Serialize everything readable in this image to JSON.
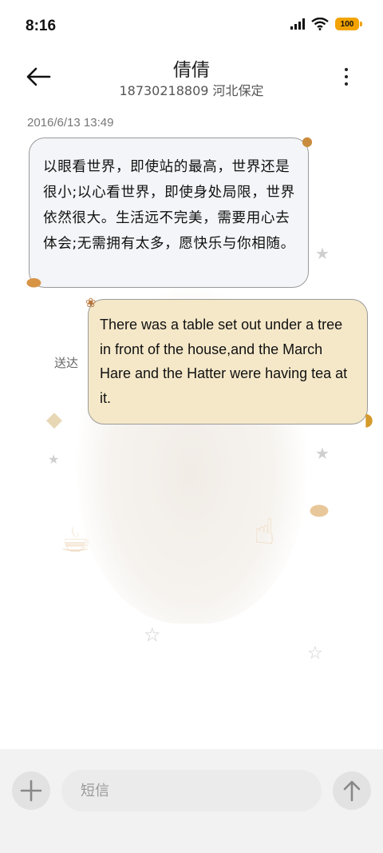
{
  "status_bar": {
    "time": "8:16",
    "battery": "100",
    "battery_color": "#f2a300"
  },
  "header": {
    "contact_name": "倩倩",
    "contact_subtitle": "18730218809 河北保定",
    "back_icon": "arrow-left-icon",
    "more_icon": "more-vertical-icon"
  },
  "conversation": {
    "timestamp": "2016/6/13 13:49",
    "messages": [
      {
        "direction": "received",
        "text": "以眼看世界，即使站的最高，世界还是很小;以心看世界，即使身处局限，世界依然很大。生活远不完美，需要用心去体会;无需拥有太多，愿快乐与你相随。",
        "bubble_color": "#f3f5f8"
      },
      {
        "direction": "sent",
        "text": "There was a table set out under a tree in front of the house,and the March Hare and the Hatter were having tea at it.",
        "bubble_color": "#f5e8c9"
      }
    ],
    "delivered_label": "送达"
  },
  "input_bar": {
    "placeholder": "短信",
    "add_icon": "plus-icon",
    "send_icon": "arrow-up-icon"
  }
}
